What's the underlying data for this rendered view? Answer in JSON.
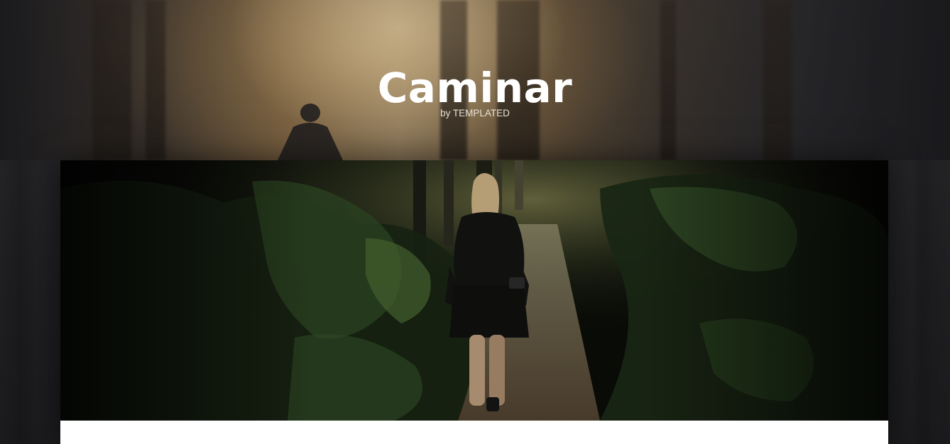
{
  "header": {
    "title": "Caminar",
    "byline": "by TEMPLATED"
  },
  "hero": {
    "image_icon": "woman-walking-forest-path-photo"
  },
  "colors": {
    "page_background": "#1f1f22",
    "title_text": "#ffffff",
    "panel_background": "#ffffff",
    "sunlight": "#c8a878"
  }
}
